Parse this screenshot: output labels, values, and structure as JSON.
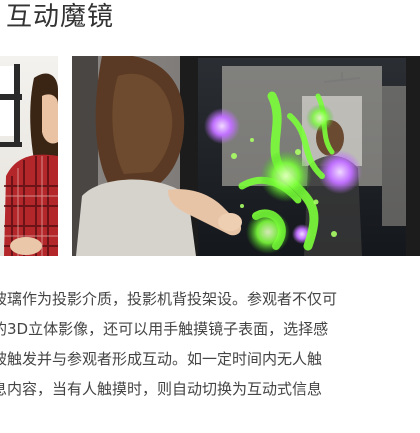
{
  "article": {
    "title": "互动魔镜",
    "paragraph_lines": [
      "玻璃作为投影介质，投影机背投架设。参观者不仅可",
      "的3D立体影像，还可以用手触摸镜子表面，选择感",
      "被触发并与参观者形成互动。如一定时间内无人触",
      "息内容，当有人触摸时，则自动切换为互动式信息"
    ]
  },
  "images": {
    "left_photo": "woman-in-plaid-shirt-photo",
    "right_photo": "woman-touching-interactive-mirror-photo"
  },
  "colors": {
    "title_text": "#333333",
    "body_text": "#444444",
    "glow_green": "#7cff3a",
    "glow_purple": "#c070ff"
  }
}
